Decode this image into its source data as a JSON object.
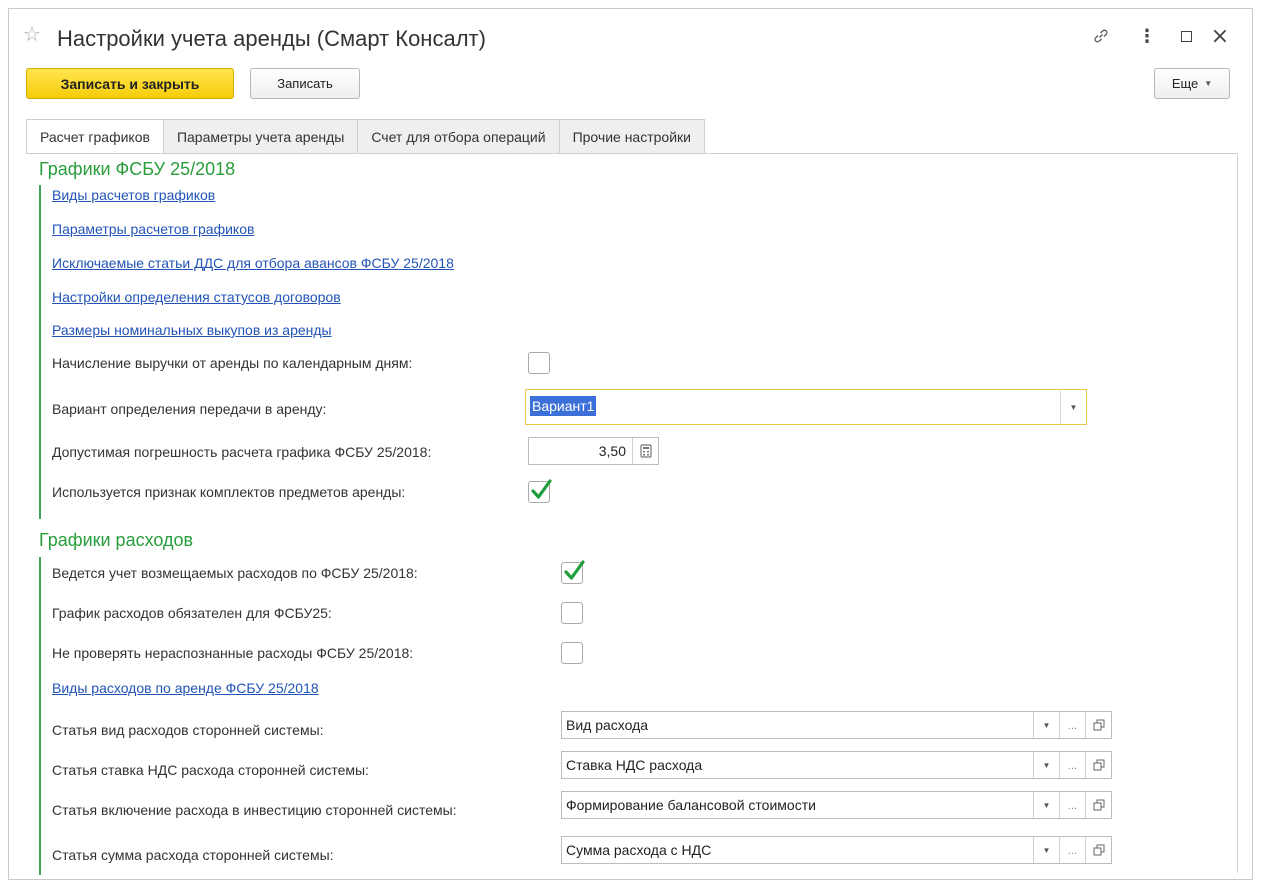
{
  "window": {
    "title": "Настройки учета аренды (Смарт Консалт)"
  },
  "toolbar": {
    "save_close_label": "Записать и закрыть",
    "save_label": "Записать",
    "more_label": "Еще"
  },
  "tabs": [
    {
      "label": "Расчет графиков",
      "active": true
    },
    {
      "label": "Параметры учета аренды",
      "active": false
    },
    {
      "label": "Счет для отбора операций",
      "active": false
    },
    {
      "label": "Прочие настройки",
      "active": false
    }
  ],
  "group1": {
    "title": "Графики ФСБУ 25/2018",
    "links": [
      "Виды расчетов графиков",
      "Параметры расчетов графиков",
      "Исключаемые статьи ДДС для отбора авансов ФСБУ 25/2018",
      "Настройки определения статусов договоров",
      "Размеры номинальных выкупов из аренды"
    ],
    "revenue_calendar_days": {
      "label": "Начисление выручки от аренды по календарным дням:",
      "checked": false
    },
    "transfer_variant": {
      "label": "Вариант определения передачи в аренду:",
      "value": "Вариант1"
    },
    "tolerance": {
      "label": "Допустимая погрешность расчета графика ФСБУ 25/2018:",
      "value": "3,50"
    },
    "kits_flag": {
      "label": "Используется признак комплектов предметов аренды:",
      "checked": true
    }
  },
  "group2": {
    "title": "Графики расходов",
    "reimbursable": {
      "label": "Ведется учет возмещаемых расходов по ФСБУ 25/2018:",
      "checked": true
    },
    "schedule_required": {
      "label": "График расходов обязателен для ФСБУ25:",
      "checked": false
    },
    "skip_unrecognized": {
      "label": "Не проверять нераспознанные расходы ФСБУ 25/2018:",
      "checked": false
    },
    "expense_types_link": "Виды расходов по аренде ФСБУ 25/2018",
    "fields": [
      {
        "label": "Статья вид расходов сторонней системы:",
        "value": "Вид расхода"
      },
      {
        "label": "Статья ставка НДС расхода сторонней системы:",
        "value": "Ставка НДС расхода"
      },
      {
        "label": "Статья включение расхода в инвестицию сторонней системы:",
        "value": "Формирование балансовой стоимости"
      },
      {
        "label": "Статья сумма расхода сторонней системы:",
        "value": "Сумма расхода с НДС"
      }
    ]
  },
  "colors": {
    "accent_yellow": "#f6cd0b",
    "group_green": "#2a9d3b",
    "link_blue": "#2254b8",
    "check_green": "#1e9e3c"
  }
}
